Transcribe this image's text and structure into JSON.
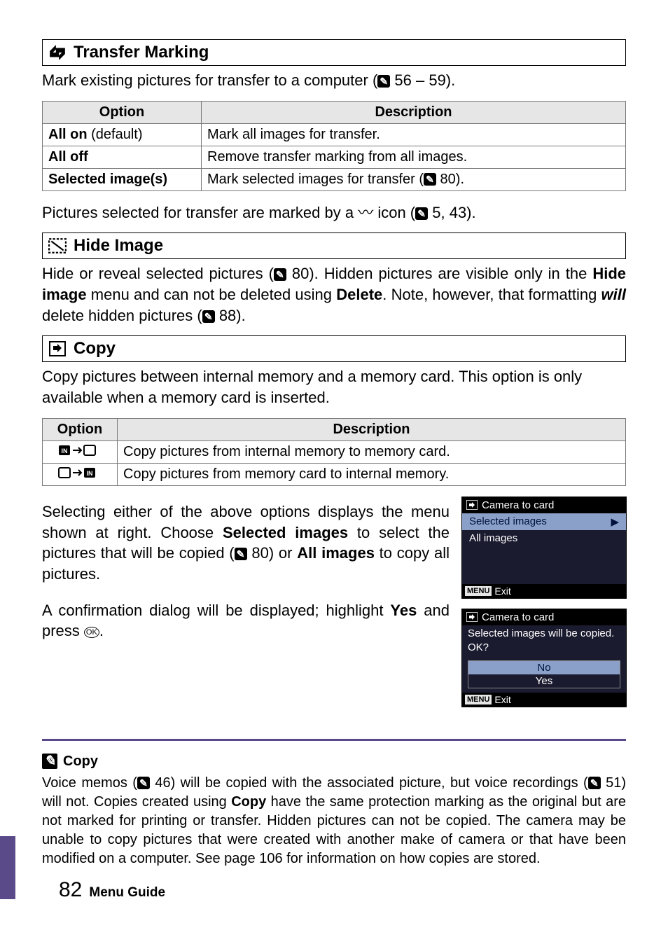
{
  "transfer": {
    "heading": "Transfer Marking",
    "intro_pre": "Mark existing pictures for transfer to a computer (",
    "intro_post": " 56 – 59).",
    "table": {
      "h_option": "Option",
      "h_desc": "Description",
      "rows": [
        {
          "opt": "All on",
          "extra": " (default)",
          "desc": "Mark all images for transfer."
        },
        {
          "opt": "All off",
          "extra": "",
          "desc": "Remove transfer marking from all images."
        },
        {
          "opt": "Selected image(s)",
          "extra": "",
          "desc_pre": "Mark selected images for transfer (",
          "desc_post": " 80)."
        }
      ]
    },
    "after_pre": "Pictures selected for transfer are marked by a ",
    "after_mid": " icon (",
    "after_post": " 5, 43).",
    "transfer_glyph": "〰"
  },
  "hide": {
    "heading": "Hide Image",
    "p1_a": "Hide or reveal selected pictures (",
    "p1_b": " 80).  Hidden pictures are visible only in the ",
    "p1_c": "Hide image",
    "p1_d": " menu and can not be deleted using ",
    "p1_e": "Delete",
    "p1_f": ".  Note, however, that formatting ",
    "p1_g": "will",
    "p1_h": " delete hidden pictures (",
    "p1_i": " 88)."
  },
  "copy": {
    "heading": "Copy",
    "intro": "Copy pictures between internal memory and a memory card.  This option is only available when a memory card is inserted.",
    "table": {
      "h_option": "Option",
      "h_desc": "Description",
      "rows": [
        {
          "opt_label": "in-to-card",
          "desc": "Copy pictures from internal memory to memory card."
        },
        {
          "opt_label": "card-to-in",
          "desc": "Copy pictures from memory card to internal memory."
        }
      ]
    },
    "sel_a": "Selecting either of the above options displays the menu shown at right.  Choose ",
    "sel_b": "Selected images",
    "sel_c": " to select the pictures that will be copied (",
    "sel_d": " 80) or ",
    "sel_e": "All images",
    "sel_f": " to copy all pictures.",
    "conf_a": "A confirmation dialog will be displayed; highlight ",
    "conf_b": "Yes",
    "conf_c": " and press ",
    "conf_d": ".",
    "ok_glyph": "OK"
  },
  "screens": {
    "s1": {
      "title": "Camera to card",
      "item1": "Selected images",
      "item2": "All images",
      "menu": "MENU",
      "exit": "Exit"
    },
    "s2": {
      "title": "Camera to card",
      "line1": "Selected images will be copied.",
      "line2": "OK?",
      "no": "No",
      "yes": "Yes",
      "menu": "MENU",
      "exit": "Exit"
    }
  },
  "note": {
    "heading": "Copy",
    "p_a": "Voice memos (",
    "p_b": " 46) will be copied with the associated picture, but voice recordings (",
    "p_c": " 51) will not.  Copies created using ",
    "p_d": "Copy",
    "p_e": " have the same protection marking as the original but are not marked for printing or transfer.  Hidden pictures can not be copied.  The camera may be unable to copy pictures that were created with another make of camera or that have been modified on a computer.  See page 106 for information on how copies are stored."
  },
  "footer": {
    "page": "82",
    "section": "Menu Guide"
  },
  "glyphs": {
    "book": "✎",
    "arrow_right": "▶"
  }
}
